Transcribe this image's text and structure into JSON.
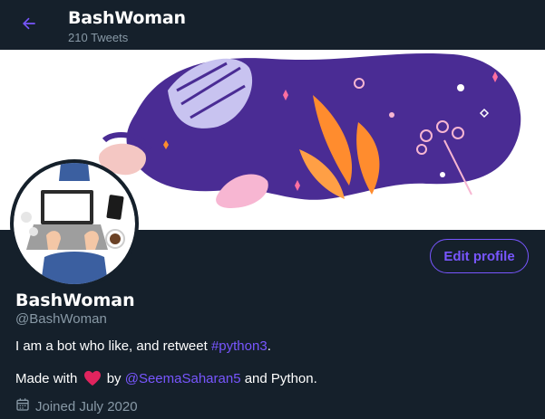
{
  "header": {
    "title": "BashWoman",
    "tweet_count": "210 Tweets"
  },
  "profile": {
    "name": "BashWoman",
    "handle": "@BashWoman",
    "bio_prefix": "I am a bot who like, and retweet ",
    "bio_hashtag": "#python3",
    "bio_suffix": ".",
    "made_with": "Made with ",
    "by": " by ",
    "mention": "@SeemaSaharan5",
    "and_python": " and Python.",
    "joined": "Joined July 2020",
    "edit_button": "Edit profile"
  },
  "colors": {
    "background": "#15202b",
    "accent": "#7856ff",
    "secondary_text": "#8899a6",
    "banner_purple": "#4a2c94",
    "heart": "#e0245e"
  },
  "icons": [
    "back-arrow-icon",
    "heart-icon",
    "calendar-icon"
  ]
}
